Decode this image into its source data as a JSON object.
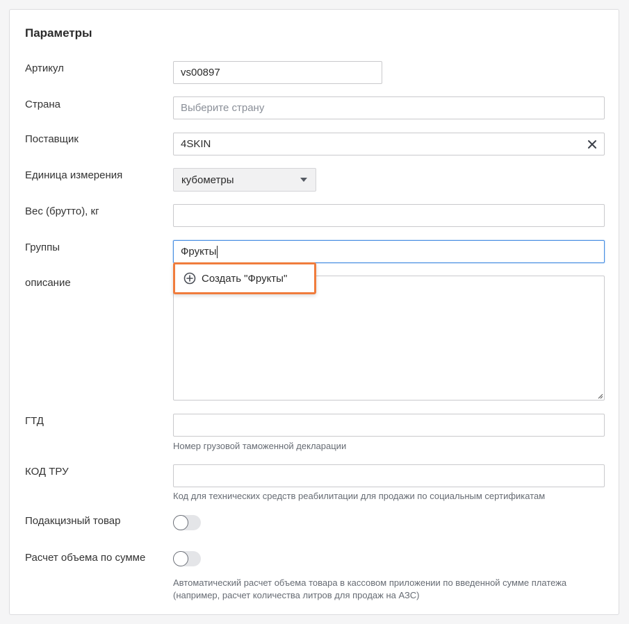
{
  "section": {
    "title": "Параметры"
  },
  "fields": {
    "article": {
      "label": "Артикул",
      "value": "vs00897"
    },
    "country": {
      "label": "Страна",
      "placeholder": "Выберите страну"
    },
    "supplier": {
      "label": "Поставщик",
      "value": "4SKIN"
    },
    "unit": {
      "label": "Единица измерения",
      "value": "кубометры"
    },
    "weight": {
      "label": "Вес (брутто), кг",
      "value": ""
    },
    "groups": {
      "label": "Группы",
      "value": "Фрукты"
    },
    "description": {
      "label": "описание",
      "value": ""
    },
    "gtd": {
      "label": "ГТД",
      "value": "",
      "hint": "Номер грузовой таможенной декларации"
    },
    "tru_code": {
      "label": "КОД ТРУ",
      "value": "",
      "hint": "Код для технических средств реабилитации для продажи по социальным сертификатам"
    },
    "excise": {
      "label": "Подакцизный товар",
      "enabled": false
    },
    "volume_calc": {
      "label": "Расчет объема по сумме",
      "enabled": false,
      "hint_line1": "Автоматический расчет объема товара в кассовом приложении по введенной сумме платежа",
      "hint_line2": "(например, расчет количества литров для продаж на АЗС)"
    }
  },
  "dropdown": {
    "create_option": "Создать \"Фрукты\"",
    "icon": "plus-circle-icon"
  },
  "colors": {
    "highlight": "#f07c3c",
    "focus": "#4a90e2",
    "toggle_off": "#e4e5e8"
  }
}
